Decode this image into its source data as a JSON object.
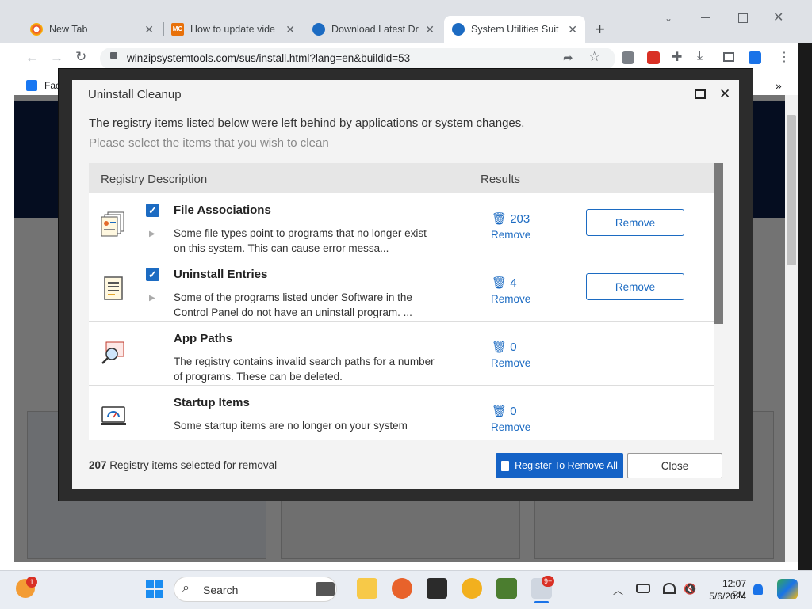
{
  "browser": {
    "tabs": [
      {
        "label": "New Tab",
        "active": false
      },
      {
        "label": "How to update vide",
        "active": false
      },
      {
        "label": "Download Latest Dr",
        "active": false
      },
      {
        "label": "System Utilities Suit",
        "active": true
      }
    ],
    "new_tab_glyph": "+",
    "url": "winzipsystemtools.com/sus/install.html?lang=en&buildid=53",
    "bookmark_label": "Fac",
    "bookmarks_more": "»"
  },
  "dialog": {
    "title": "Uninstall Cleanup",
    "subtitle": "The registry items listed below were left behind by applications or system changes.",
    "instruction": "Please select the items that you wish to clean",
    "col_description": "Registry Description",
    "col_results": "Results",
    "rows": [
      {
        "title": "File Associations",
        "desc": "Some file types point to programs that no longer exist on this system. This can cause error messa...",
        "count": "203",
        "link": "Remove",
        "button": "Remove",
        "checked": true,
        "icon": "file-associations-icon"
      },
      {
        "title": "Uninstall Entries",
        "desc": "Some of the programs listed under Software in the Control Panel do not have an uninstall program. ...",
        "count": "4",
        "link": "Remove",
        "button": "Remove",
        "checked": true,
        "icon": "uninstall-entries-icon"
      },
      {
        "title": "App Paths",
        "desc": "The registry contains invalid search paths for a number of programs. These can be deleted.",
        "count": "0",
        "link": "Remove",
        "checked": false,
        "icon": "app-paths-icon"
      },
      {
        "title": "Startup Items",
        "desc": "Some startup items are no longer on your system",
        "count": "0",
        "link": "Remove",
        "checked": false,
        "icon": "startup-items-icon"
      }
    ],
    "footer_count": "207",
    "footer_text": "Registry items selected for removal",
    "primary_button": "Register To Remove All",
    "close_button": "Close",
    "accent_color": "#1462c6"
  },
  "taskbar": {
    "search_placeholder": "Search",
    "time": "12:07 PM",
    "date": "5/6/2024",
    "badge_count": "9+",
    "notif_badge": "1"
  }
}
